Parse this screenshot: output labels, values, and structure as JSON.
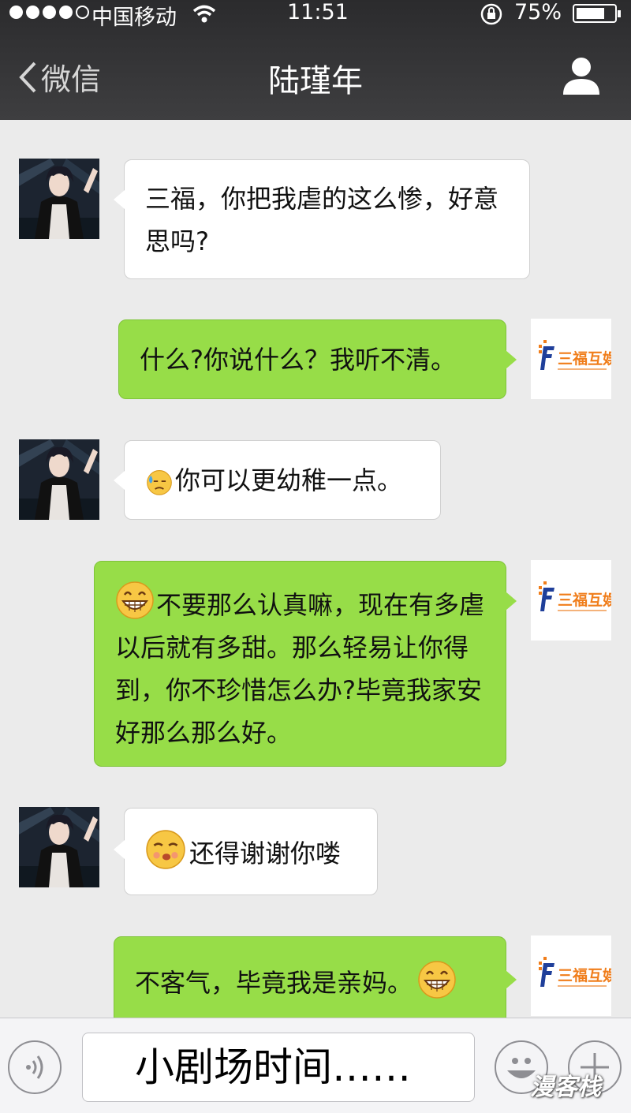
{
  "status_bar": {
    "carrier": "中国移动",
    "time": "11:51",
    "battery_percent": "75%",
    "battery_level": 0.75,
    "signal_bars_filled": 4,
    "signal_bars_total": 5
  },
  "nav": {
    "back_label": "微信",
    "title": "陆瑾年"
  },
  "logo_text": "三福互娱",
  "messages": [
    {
      "sender": "contact",
      "text": "三福，你把我虐的这么惨，好意思吗?"
    },
    {
      "sender": "me",
      "text": "什么?你说什么？我听不清。"
    },
    {
      "sender": "contact",
      "emoji": "sweat-icon",
      "text": "你可以更幼稚一点。"
    },
    {
      "sender": "me",
      "emoji": "grin-icon",
      "text": "不要那么认真嘛，现在有多虐以后就有多甜。那么轻易让你得到，你不珍惜怎么办?毕竟我家安好那么那么好。"
    },
    {
      "sender": "contact",
      "emoji": "smirk-icon",
      "text": "还得谢谢你喽"
    },
    {
      "sender": "me",
      "text": "不客气，毕竟我是亲妈。",
      "trailing_emoji": "grin-icon"
    }
  ],
  "input_bar": {
    "text": "小剧场时间……",
    "watermark": "漫客栈"
  },
  "colors": {
    "nav_bg": "#2e2e30",
    "chat_bg": "#ebebeb",
    "outgoing_bubble": "#97dd48",
    "incoming_bubble": "#ffffff"
  }
}
